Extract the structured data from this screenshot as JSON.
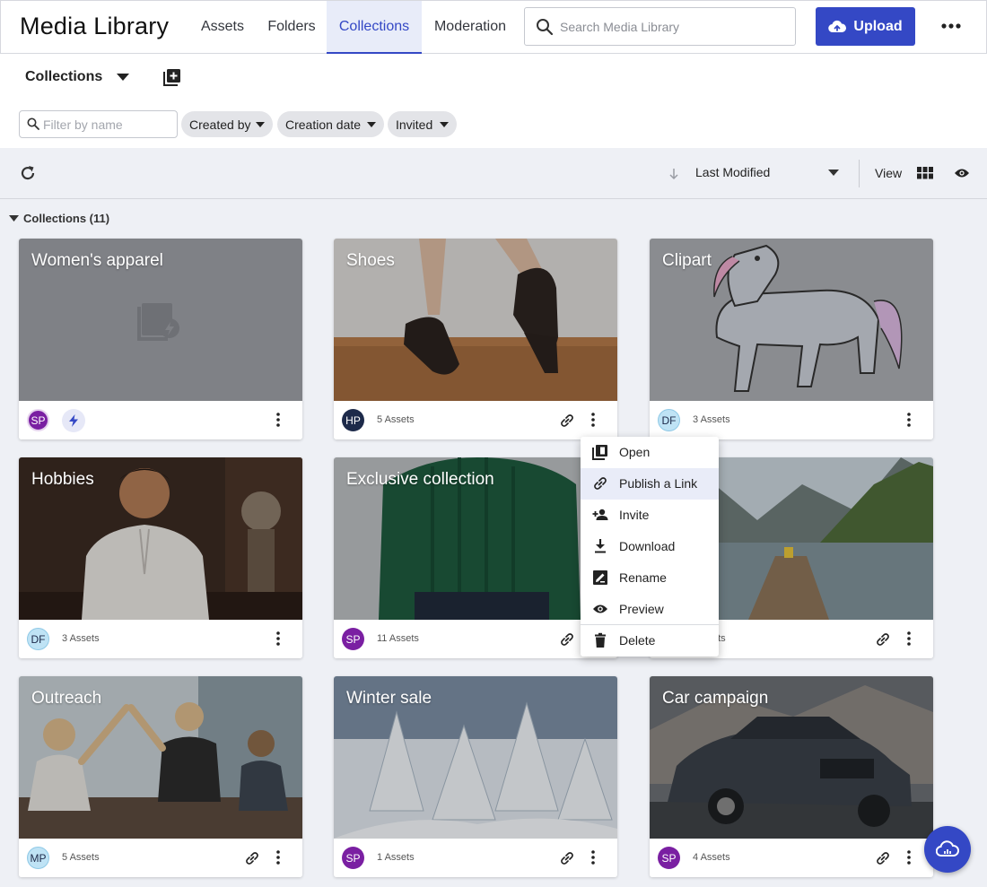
{
  "app": {
    "title": "Media Library"
  },
  "nav": {
    "tabs": [
      {
        "label": "Assets"
      },
      {
        "label": "Folders"
      },
      {
        "label": "Collections"
      },
      {
        "label": "Moderation"
      }
    ]
  },
  "search": {
    "placeholder": "Search Media Library"
  },
  "upload": {
    "label": "Upload"
  },
  "subheader": {
    "title": "Collections"
  },
  "filters": {
    "name_placeholder": "Filter by name",
    "chips": [
      {
        "label": "Created by"
      },
      {
        "label": "Creation date"
      },
      {
        "label": "Invited"
      }
    ]
  },
  "toolbar": {
    "sort_label": "Last Modified",
    "view_label": "View"
  },
  "section": {
    "label": "Collections (11)"
  },
  "colors": {
    "accent": "#3448c5",
    "purple_avatar": "#7a1fa2",
    "navy_avatar": "#1d2a4a",
    "light_avatar": "#bfe3f5"
  },
  "cards": [
    {
      "title": "Women's apparel",
      "avatar": "SP",
      "count": "",
      "icon": "collection-placeholder-icon"
    },
    {
      "title": "Shoes",
      "avatar": "HP",
      "count": "5 Assets"
    },
    {
      "title": "Clipart",
      "avatar": "DF",
      "count": "3 Assets"
    },
    {
      "title": "Hobbies",
      "avatar": "DF",
      "count": "3 Assets"
    },
    {
      "title": "Exclusive collection",
      "avatar": "SP",
      "count": "11 Assets"
    },
    {
      "title": "",
      "avatar": "",
      "count": "ets"
    },
    {
      "title": "Outreach",
      "avatar": "MP",
      "count": "5 Assets"
    },
    {
      "title": "Winter sale",
      "avatar": "SP",
      "count": "1 Assets"
    },
    {
      "title": "Car campaign",
      "avatar": "SP",
      "count": "4 Assets"
    }
  ],
  "menu": {
    "items": [
      {
        "label": "Open"
      },
      {
        "label": "Publish a Link"
      },
      {
        "label": "Invite"
      },
      {
        "label": "Download"
      },
      {
        "label": "Rename"
      },
      {
        "label": "Preview"
      },
      {
        "label": "Delete"
      }
    ]
  }
}
